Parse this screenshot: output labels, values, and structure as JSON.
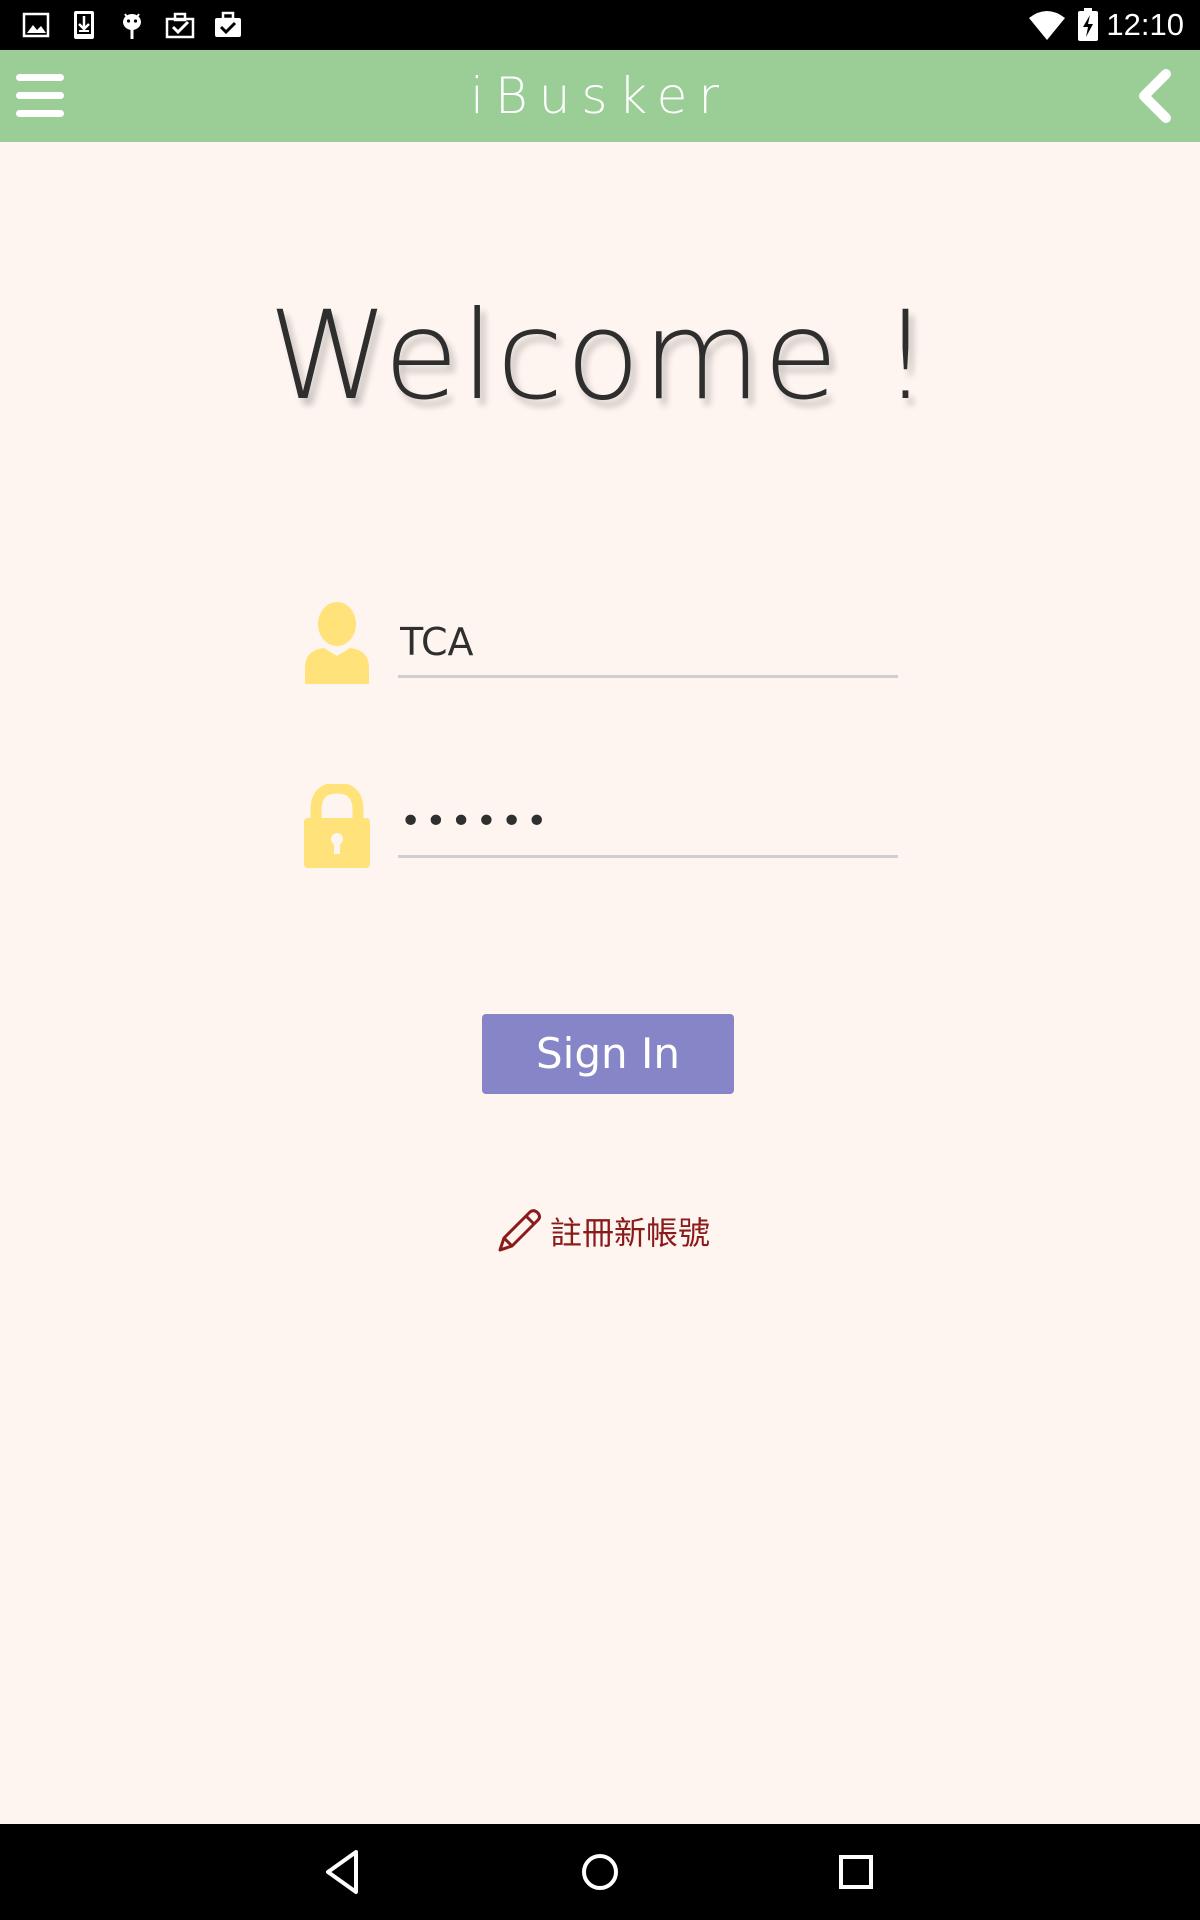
{
  "status_bar": {
    "time": "12:10",
    "icons": [
      "image-icon",
      "download-icon",
      "android-icon",
      "clipboard-check-icon",
      "briefcase-check-icon",
      "wifi-icon",
      "battery-charging-icon"
    ]
  },
  "app_bar": {
    "title": "iBusker",
    "menu_icon": "hamburger-menu-icon",
    "back_icon": "chevron-left-icon"
  },
  "welcome": {
    "text": "Welcome !"
  },
  "login": {
    "username_value": "TCA",
    "password_value": "••••••",
    "username_icon": "person-icon",
    "password_icon": "lock-icon",
    "icon_color": "#ffe27a"
  },
  "sign_in": {
    "label": "Sign In",
    "color": "#8585c7"
  },
  "register": {
    "label": "註冊新帳號",
    "icon": "pencil-icon",
    "color": "#8b1a1a"
  },
  "nav_bar": {
    "icons": [
      "back-triangle-icon",
      "home-circle-icon",
      "recents-square-icon"
    ]
  },
  "colors": {
    "app_bar": "#9bcd97",
    "background": "#fef5f0"
  }
}
